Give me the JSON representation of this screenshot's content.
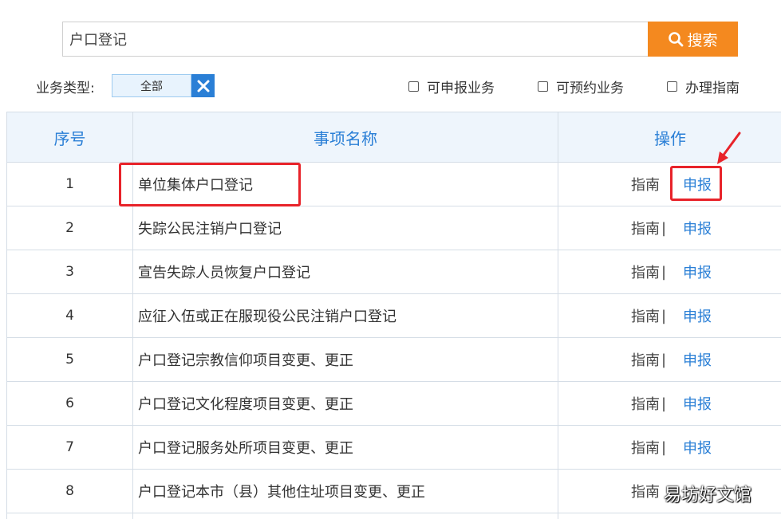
{
  "search": {
    "value": "户口登记",
    "button_label": "搜索"
  },
  "filters": {
    "type_label": "业务类型:",
    "type_value": "全部",
    "options": [
      {
        "label": "可申报业务"
      },
      {
        "label": "可预约业务"
      },
      {
        "label": "办理指南"
      }
    ]
  },
  "table": {
    "headers": {
      "no": "序号",
      "name": "事项名称",
      "ops": "操作"
    },
    "guide_label": "指南",
    "separator": "|",
    "apply_label": "申报",
    "rows": [
      {
        "no": "1",
        "name": "单位集体户口登记"
      },
      {
        "no": "2",
        "name": "失踪公民注销户口登记"
      },
      {
        "no": "3",
        "name": "宣告失踪人员恢复户口登记"
      },
      {
        "no": "4",
        "name": "应征入伍或正在服现役公民注销户口登记"
      },
      {
        "no": "5",
        "name": "户口登记宗教信仰项目变更、更正"
      },
      {
        "no": "6",
        "name": "户口登记文化程度项目变更、更正"
      },
      {
        "no": "7",
        "name": "户口登记服务处所项目变更、更正"
      },
      {
        "no": "8",
        "name": "户口登记本市（县）其他住址项目变更、更正"
      }
    ]
  },
  "watermark": "易坊好文馆",
  "colors": {
    "accent": "#2a7fd6",
    "search_button": "#f4891f",
    "highlight": "#e8232a"
  }
}
